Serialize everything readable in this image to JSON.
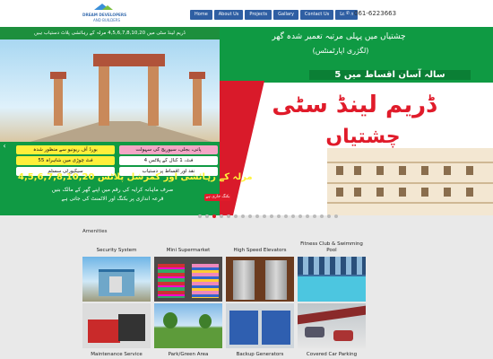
{
  "header": {
    "logo": {
      "line1": "DREAM DEVELOPERS",
      "line2": "AND BUILDERS"
    },
    "nav": [
      "Home",
      "About Us",
      "Projects",
      "Gallary",
      "Contact Us",
      "Log In"
    ],
    "phone": "061-6223663"
  },
  "banner": {
    "top_strip": "ڈریم لینڈ سٹی میں 4,5,6,7,8,10,20 مرلہ کے رہائشی پلاٹ دستیاب ہیں",
    "headline1": "چشتیاں میں پہلی مرتبہ تعمیر شدہ گھر",
    "headline2": "(لگژری اپارٹمنٹس)",
    "installments": "5 سالہ آسان اقساط میں",
    "title": "ڈریم لینڈ سٹی",
    "subtitle": "چشتیاں",
    "features": [
      "بورڈ آف ریونیو سے منظور شدہ",
      "پانی، بجلی، سیوریج کی سہولت",
      "55 فٹ چوڑی مین شاہراہ",
      "4 فٹ، 1 کنال کے پلاٹس",
      "سیکیورٹی سسٹم",
      "نقد اور اقساط پر دستیاب"
    ],
    "sizes": "4,5,6,7,8,10,20 مرلہ کے رہائشی اور کمرشل پلاٹس",
    "line1": "صرف ماہانہ کرایہ کی رقم میں اپنے گھر کے مالک بنیں",
    "line2": "قرعہ اندازی پر بکنگ اور الاٹمنٹ کی جاتی ہے",
    "tag": "بکنگ جاری ہے",
    "prev": "‹",
    "next": "›"
  },
  "slider": {
    "count": 20,
    "active": 2
  },
  "amenities": {
    "title": "Amenities",
    "items": [
      {
        "label": "Security System"
      },
      {
        "label": "Mini Supermarket"
      },
      {
        "label": "High Speed Elevators"
      },
      {
        "label": "Fitness Club & Swimming Pool"
      },
      {
        "label": "Maintenance Service"
      },
      {
        "label": "Park/Green Area"
      },
      {
        "label": "Backup Generators"
      },
      {
        "label": "Covered Car Parking"
      }
    ]
  },
  "colors": {
    "nav": "#2f5fa3",
    "banner_green": "#109a44",
    "title_red": "#e01b2a",
    "page_bg": "#e9e9e9"
  }
}
